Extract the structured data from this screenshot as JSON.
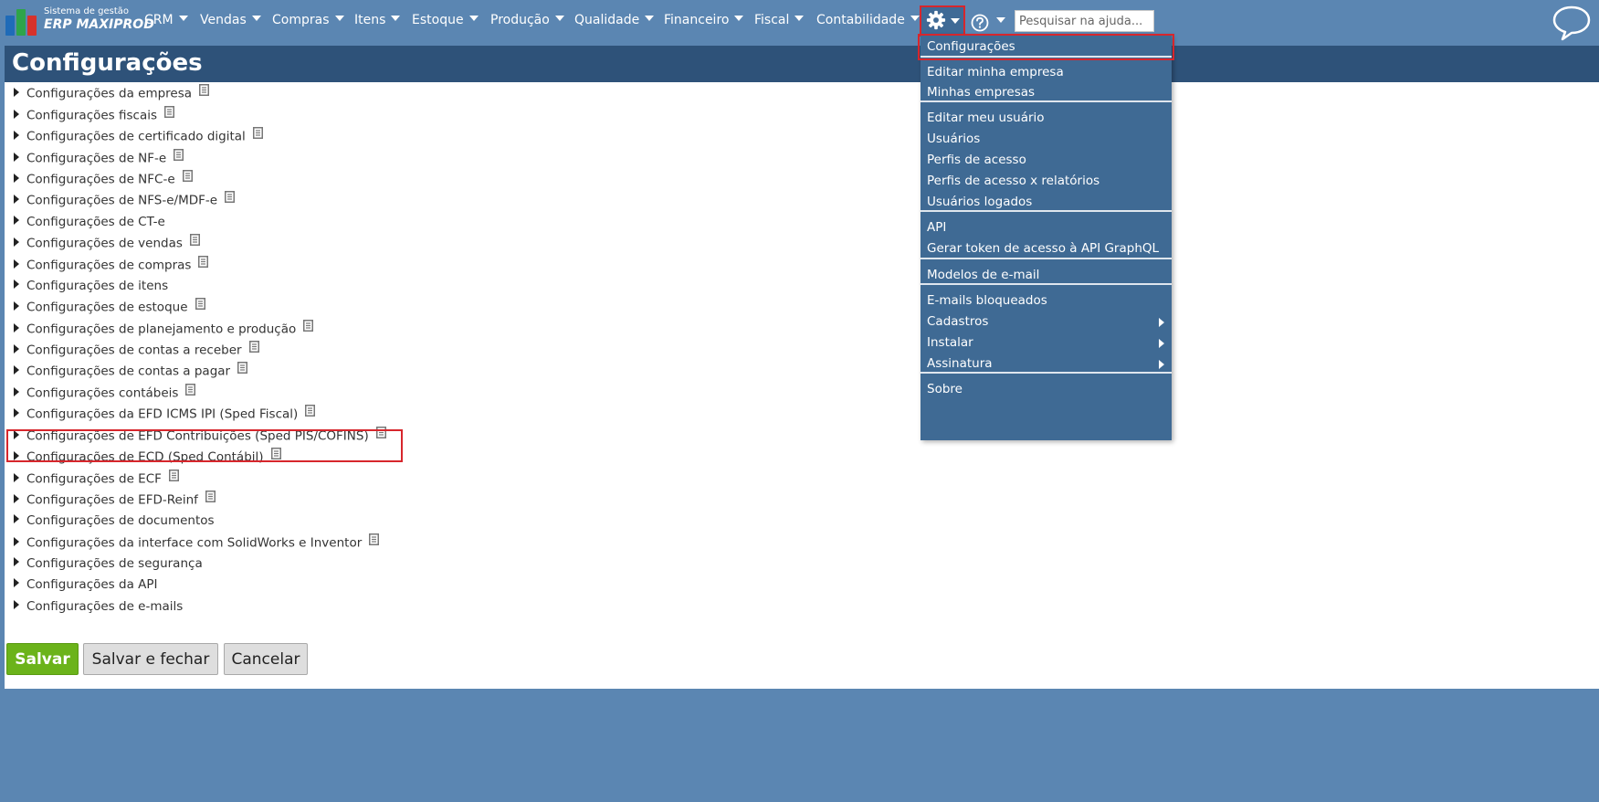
{
  "logo": {
    "line1": "Sistema de gestão",
    "line2": "ERP MAXIPROD"
  },
  "nav": {
    "items": [
      "CRM",
      "Vendas",
      "Compras",
      "Itens",
      "Estoque",
      "Produção",
      "Qualidade",
      "Financeiro",
      "Fiscal",
      "Contabilidade"
    ],
    "search_placeholder": "Pesquisar na ajuda..."
  },
  "page": {
    "title": "Configurações",
    "items": [
      "Configurações da empresa",
      "Configurações fiscais",
      "Configurações de certificado digital",
      "Configurações de NF-e",
      "Configurações de NFC-e",
      "Configurações de NFS-e/MDF-e",
      "Configurações de CT-e",
      "Configurações de vendas",
      "Configurações de compras",
      "Configurações de itens",
      "Configurações de estoque",
      "Configurações de planejamento e produção",
      "Configurações de contas a receber",
      "Configurações de contas a pagar",
      "Configurações contábeis",
      "Configurações da EFD ICMS IPI (Sped Fiscal)",
      "Configurações de EFD Contribuições (Sped PIS/COFINS)",
      "Configurações de ECD (Sped Contábil)",
      "Configurações de ECF",
      "Configurações de EFD-Reinf",
      "Configurações de documentos",
      "Configurações da interface com SolidWorks e Inventor",
      "Configurações de segurança",
      "Configurações da API",
      "Configurações de e-mails"
    ],
    "buttons": {
      "save": "Salvar",
      "save_close": "Salvar e fechar",
      "cancel": "Cancelar"
    }
  },
  "dropdown": {
    "items": [
      "Configurações",
      "Editar minha empresa",
      "Minhas empresas",
      "Editar meu usuário",
      "Usuários",
      "Perfis de acesso",
      "Perfis de acesso x relatórios",
      "Usuários logados",
      "API",
      "Gerar token de acesso à API GraphQL",
      "Modelos de e-mail",
      "E-mails bloqueados",
      "Cadastros",
      "Instalar",
      "Assinatura",
      "Sobre"
    ]
  },
  "colors": {
    "background": "#5b86b2",
    "header": "#2e5279",
    "dropdown": "#3f6a94",
    "highlight": "#d7262c",
    "save_button": "#6bb31a"
  }
}
